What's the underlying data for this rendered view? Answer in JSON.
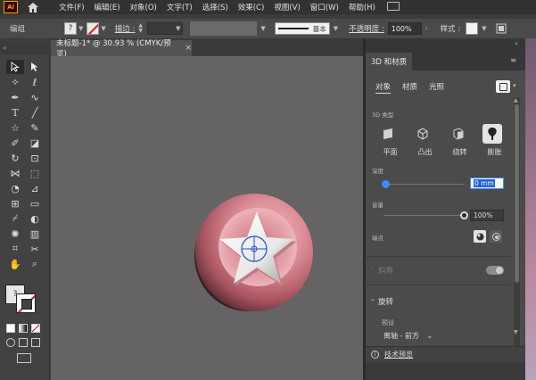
{
  "app": {
    "logo": "Ai",
    "menu": [
      "文件(F)",
      "编辑(E)",
      "对象(O)",
      "文字(T)",
      "选择(S)",
      "效果(C)",
      "视图(V)",
      "窗口(W)",
      "帮助(H)"
    ]
  },
  "control_bar": {
    "selection_label": "编组",
    "fill_value": "?",
    "stroke_label": "描边 :",
    "brush_label": "基本",
    "opacity_label": "不透明度 :",
    "opacity_value": "100%",
    "style_label": "样式 :"
  },
  "document": {
    "tab_title": "未标题-1* @ 30.93 % (CMYK/预览)",
    "close_glyph": "×"
  },
  "tools": {
    "fill_stroke_value": "?"
  },
  "panel": {
    "title": "3D 和材质",
    "tabs": [
      "对象",
      "材质",
      "光照"
    ],
    "active_tab": "对象",
    "type_section_label": "3D 类型",
    "types": [
      "平面",
      "凸出",
      "绕转",
      "膨胀"
    ],
    "selected_type": "膨胀",
    "depth_label": "深度",
    "depth_value": "0 mm",
    "depth_fraction": 0.0,
    "volume_label": "音量",
    "volume_value": "100%",
    "volume_fraction": 1.0,
    "cap_label": "端点",
    "bevel_label": "斜角",
    "rotation_title": "旋转",
    "preset_label": "预设",
    "preset_value": "离轴 - 前方",
    "footer_label": "技术预览"
  },
  "colors": {
    "accent_blue": "#3a8ff0",
    "art_pink": "#d98a96",
    "star_white": "#f0f0f0"
  }
}
